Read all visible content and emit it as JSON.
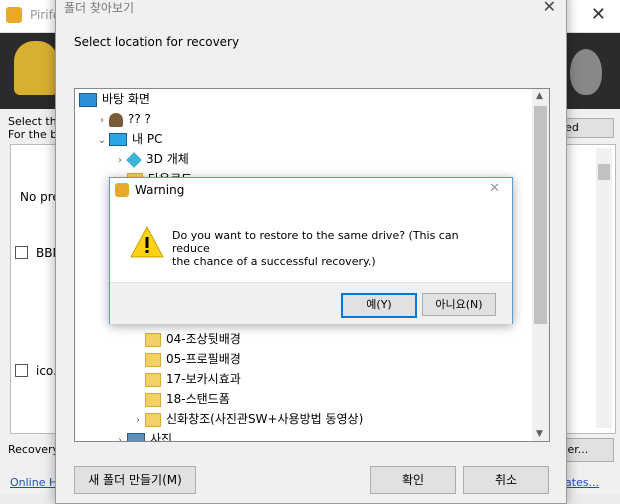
{
  "background_app": {
    "title": "Pirifo",
    "select_text": [
      "Select the",
      "For the be"
    ],
    "advanced_mode": "ced mode",
    "no_preview": "No pre",
    "bbm": "BBM",
    "ico": "ico.",
    "recovery": "Recovery",
    "overwrite_button": "ver...",
    "online_help": "Online He",
    "updates_link": "lates..."
  },
  "browse_dialog": {
    "title": "폴더 찾아보기",
    "caption": "Select location for recovery",
    "tree": [
      {
        "label": "바탕 화면",
        "icon": "desktop-icon",
        "expander": "",
        "indent": 0
      },
      {
        "label": "?? ?",
        "icon": "user-icon",
        "expander": "›",
        "indent": 1
      },
      {
        "label": "내 PC",
        "icon": "pc-icon",
        "expander": "⌄",
        "indent": 1
      },
      {
        "label": "3D 개체",
        "icon": "3d-objects-icon",
        "expander": "›",
        "indent": 2
      },
      {
        "label": "다운로드",
        "icon": "folder-icon",
        "expander": "›",
        "indent": 2
      },
      {
        "label": "",
        "icon": "",
        "expander": "›",
        "indent": 2
      },
      {
        "label": "",
        "icon": "",
        "expander": "›",
        "indent": 2
      },
      {
        "label": "",
        "icon": "",
        "expander": "⌄",
        "indent": 2
      },
      {
        "label": "",
        "icon": "",
        "expander": "",
        "indent": 3
      },
      {
        "label": "",
        "icon": "",
        "expander": "",
        "indent": 3
      },
      {
        "label": "",
        "icon": "",
        "expander": "",
        "indent": 3
      },
      {
        "label": "",
        "icon": "",
        "expander": "",
        "indent": 3
      },
      {
        "label": "04-조상뒷배경",
        "icon": "folder-icon",
        "expander": "",
        "indent": 3
      },
      {
        "label": "05-프로필배경",
        "icon": "folder-icon",
        "expander": "",
        "indent": 3
      },
      {
        "label": "17-보카시효과",
        "icon": "folder-icon",
        "expander": "",
        "indent": 3
      },
      {
        "label": "18-스탠드폼",
        "icon": "folder-icon",
        "expander": "",
        "indent": 3
      },
      {
        "label": "신화창조(사진관SW+사용방법 동영상)",
        "icon": "folder-icon",
        "expander": "›",
        "indent": 3
      },
      {
        "label": "사진",
        "icon": "pictures-icon",
        "expander": "›",
        "indent": 2
      }
    ],
    "new_folder_button": "새 폴더 만들기(M)",
    "ok_button": "확인",
    "cancel_button": "취소"
  },
  "warning_dialog": {
    "title": "Warning",
    "message_line1": "Do you want to restore to the same drive? (This can reduce",
    "message_line2": "the chance of a successful recovery.)",
    "yes_button": "예(Y)",
    "no_button": "아니요(N)",
    "icon": "warning-icon"
  }
}
